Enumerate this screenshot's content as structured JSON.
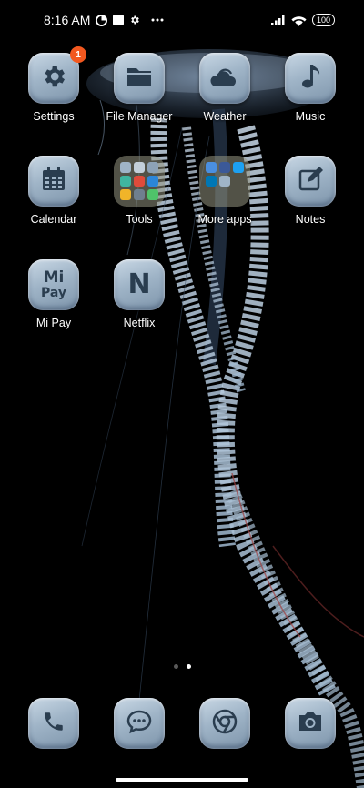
{
  "status_bar": {
    "time": "8:16 AM",
    "battery": "100",
    "left_icons": [
      "data-saver-icon",
      "square-icon",
      "gear-icon",
      "more-dots-icon"
    ],
    "right_icons": [
      "signal-icon",
      "wifi-icon",
      "battery-icon"
    ]
  },
  "apps": [
    {
      "label": "Settings",
      "icon": "gear-icon",
      "badge": "1"
    },
    {
      "label": "File Manager",
      "icon": "folder-icon"
    },
    {
      "label": "Weather",
      "icon": "cloud-sun-icon"
    },
    {
      "label": "Music",
      "icon": "music-note-icon"
    },
    {
      "label": "Calendar",
      "icon": "calendar-icon"
    },
    {
      "label": "Tools",
      "icon": "folder-icon"
    },
    {
      "label": "More apps",
      "icon": "folder-icon"
    },
    {
      "label": "Notes",
      "icon": "pencil-icon"
    },
    {
      "label": "Mi Pay",
      "icon": "mi-pay-icon",
      "icon_text_top": "Mi",
      "icon_text_bottom": "Pay"
    },
    {
      "label": "Netflix",
      "icon": "netflix-icon",
      "icon_text": "N"
    }
  ],
  "dock": [
    {
      "name": "Phone",
      "icon": "phone-icon"
    },
    {
      "name": "Messages",
      "icon": "message-icon"
    },
    {
      "name": "Chrome",
      "icon": "chrome-icon"
    },
    {
      "name": "Camera",
      "icon": "camera-icon"
    }
  ],
  "page_indicator": {
    "pages": 2,
    "current": 2
  },
  "colors": {
    "icon_tile": "#9fb4c7",
    "glyph": "#2a3d4f",
    "badge": "#f2581f",
    "wallpaper_bg": "#000000",
    "jellyfish": "#b8cde0"
  }
}
